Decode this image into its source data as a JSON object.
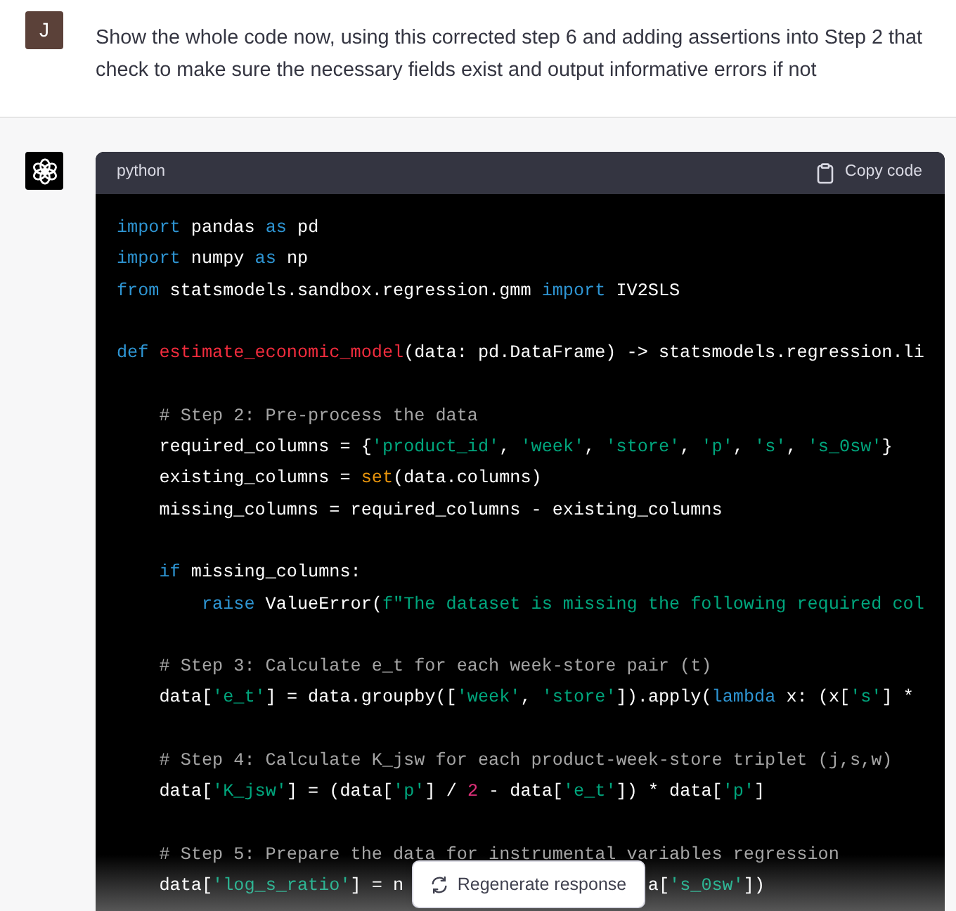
{
  "user_message": {
    "avatar_initial": "J",
    "text": "Show the whole code now, using this corrected step 6 and adding assertions into Step 2 that check to make sure the necessary fields exist and output informative errors if not"
  },
  "assistant_message": {
    "code_block": {
      "language": "python",
      "copy_button": "Copy code",
      "lines": [
        {
          "kind": "code",
          "tokens": [
            {
              "t": "import",
              "kind": "kw"
            },
            {
              "t": " pandas ",
              "kind": "plain"
            },
            {
              "t": "as",
              "kind": "kw"
            },
            {
              "t": " pd",
              "kind": "plain"
            }
          ]
        },
        {
          "kind": "code",
          "tokens": [
            {
              "t": "import",
              "kind": "kw"
            },
            {
              "t": " numpy ",
              "kind": "plain"
            },
            {
              "t": "as",
              "kind": "kw"
            },
            {
              "t": " np",
              "kind": "plain"
            }
          ]
        },
        {
          "kind": "code",
          "tokens": [
            {
              "t": "from",
              "kind": "kw"
            },
            {
              "t": " statsmodels.sandbox.regression.gmm ",
              "kind": "plain"
            },
            {
              "t": "import",
              "kind": "kw"
            },
            {
              "t": " IV2SLS",
              "kind": "plain"
            }
          ]
        },
        {
          "kind": "blank"
        },
        {
          "kind": "code",
          "tokens": [
            {
              "t": "def ",
              "kind": "kw"
            },
            {
              "t": "estimate_economic_model",
              "kind": "fn"
            },
            {
              "t": "(data: pd.DataFrame) -> statsmodels.regression.li",
              "kind": "plain"
            }
          ]
        },
        {
          "kind": "blank"
        },
        {
          "kind": "code",
          "tokens": [
            {
              "t": "    # Step 2: Pre-process the data",
              "kind": "cm"
            }
          ]
        },
        {
          "kind": "code",
          "tokens": [
            {
              "t": "    required_columns = {",
              "kind": "plain"
            },
            {
              "t": "'product_id'",
              "kind": "str"
            },
            {
              "t": ", ",
              "kind": "plain"
            },
            {
              "t": "'week'",
              "kind": "str"
            },
            {
              "t": ", ",
              "kind": "plain"
            },
            {
              "t": "'store'",
              "kind": "str"
            },
            {
              "t": ", ",
              "kind": "plain"
            },
            {
              "t": "'p'",
              "kind": "str"
            },
            {
              "t": ", ",
              "kind": "plain"
            },
            {
              "t": "'s'",
              "kind": "str"
            },
            {
              "t": ", ",
              "kind": "plain"
            },
            {
              "t": "'s_0sw'",
              "kind": "str"
            },
            {
              "t": "}",
              "kind": "plain"
            }
          ]
        },
        {
          "kind": "code",
          "tokens": [
            {
              "t": "    existing_columns = ",
              "kind": "plain"
            },
            {
              "t": "set",
              "kind": "builtin"
            },
            {
              "t": "(data.columns)",
              "kind": "plain"
            }
          ]
        },
        {
          "kind": "code",
          "tokens": [
            {
              "t": "    missing_columns = required_columns - existing_columns",
              "kind": "plain"
            }
          ]
        },
        {
          "kind": "blank"
        },
        {
          "kind": "code",
          "tokens": [
            {
              "t": "    if",
              "kind": "kw"
            },
            {
              "t": " missing_columns:",
              "kind": "plain"
            }
          ]
        },
        {
          "kind": "code",
          "tokens": [
            {
              "t": "        raise",
              "kind": "kw"
            },
            {
              "t": " ValueError(",
              "kind": "plain"
            },
            {
              "t": "f\"The dataset is missing the following required col",
              "kind": "str"
            }
          ]
        },
        {
          "kind": "blank"
        },
        {
          "kind": "code",
          "tokens": [
            {
              "t": "    # Step 3: Calculate e_t for each week-store pair (t)",
              "kind": "cm"
            }
          ]
        },
        {
          "kind": "code",
          "tokens": [
            {
              "t": "    data[",
              "kind": "plain"
            },
            {
              "t": "'e_t'",
              "kind": "str"
            },
            {
              "t": "] = data.groupby([",
              "kind": "plain"
            },
            {
              "t": "'week'",
              "kind": "str"
            },
            {
              "t": ", ",
              "kind": "plain"
            },
            {
              "t": "'store'",
              "kind": "str"
            },
            {
              "t": "]).apply(",
              "kind": "plain"
            },
            {
              "t": "lambda",
              "kind": "kw"
            },
            {
              "t": " x: (x[",
              "kind": "plain"
            },
            {
              "t": "'s'",
              "kind": "str"
            },
            {
              "t": "] *",
              "kind": "plain"
            }
          ]
        },
        {
          "kind": "blank"
        },
        {
          "kind": "code",
          "tokens": [
            {
              "t": "    # Step 4: Calculate K_jsw for each product-week-store triplet (j,s,w)",
              "kind": "cm"
            }
          ]
        },
        {
          "kind": "code",
          "tokens": [
            {
              "t": "    data[",
              "kind": "plain"
            },
            {
              "t": "'K_jsw'",
              "kind": "str"
            },
            {
              "t": "] = (data[",
              "kind": "plain"
            },
            {
              "t": "'p'",
              "kind": "str"
            },
            {
              "t": "] / ",
              "kind": "plain"
            },
            {
              "t": "2",
              "kind": "num"
            },
            {
              "t": " - data[",
              "kind": "plain"
            },
            {
              "t": "'e_t'",
              "kind": "str"
            },
            {
              "t": "]) * data[",
              "kind": "plain"
            },
            {
              "t": "'p'",
              "kind": "str"
            },
            {
              "t": "]",
              "kind": "plain"
            }
          ]
        },
        {
          "kind": "blank"
        },
        {
          "kind": "code",
          "tokens": [
            {
              "t": "    # Step 5: Prepare the data for instrumental variables regression",
              "kind": "cm"
            }
          ]
        },
        {
          "kind": "covered",
          "tokens": [
            {
              "t": "    data[",
              "kind": "plain"
            },
            {
              "t": "'log_s_ratio'",
              "kind": "str"
            },
            {
              "t": "] = n",
              "kind": "plain"
            }
          ],
          "tokens_after": [
            {
              "t": "a[",
              "kind": "plain"
            },
            {
              "t": "'s_0sw'",
              "kind": "str"
            },
            {
              "t": "])",
              "kind": "plain"
            }
          ]
        }
      ]
    }
  },
  "regenerate_button": "Regenerate response"
}
